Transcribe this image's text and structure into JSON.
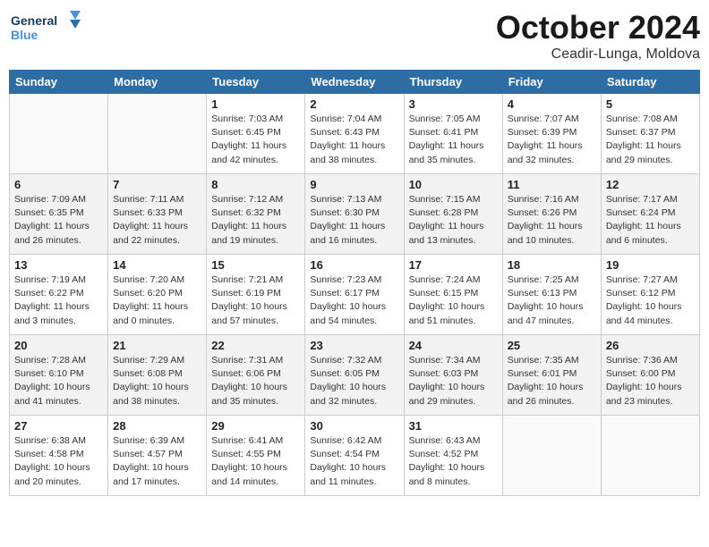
{
  "header": {
    "logo_line1": "General",
    "logo_line2": "Blue",
    "month": "October 2024",
    "location": "Ceadir-Lunga, Moldova"
  },
  "weekdays": [
    "Sunday",
    "Monday",
    "Tuesday",
    "Wednesday",
    "Thursday",
    "Friday",
    "Saturday"
  ],
  "weeks": [
    [
      {
        "day": "",
        "info": ""
      },
      {
        "day": "",
        "info": ""
      },
      {
        "day": "1",
        "info": "Sunrise: 7:03 AM\nSunset: 6:45 PM\nDaylight: 11 hours\nand 42 minutes."
      },
      {
        "day": "2",
        "info": "Sunrise: 7:04 AM\nSunset: 6:43 PM\nDaylight: 11 hours\nand 38 minutes."
      },
      {
        "day": "3",
        "info": "Sunrise: 7:05 AM\nSunset: 6:41 PM\nDaylight: 11 hours\nand 35 minutes."
      },
      {
        "day": "4",
        "info": "Sunrise: 7:07 AM\nSunset: 6:39 PM\nDaylight: 11 hours\nand 32 minutes."
      },
      {
        "day": "5",
        "info": "Sunrise: 7:08 AM\nSunset: 6:37 PM\nDaylight: 11 hours\nand 29 minutes."
      }
    ],
    [
      {
        "day": "6",
        "info": "Sunrise: 7:09 AM\nSunset: 6:35 PM\nDaylight: 11 hours\nand 26 minutes."
      },
      {
        "day": "7",
        "info": "Sunrise: 7:11 AM\nSunset: 6:33 PM\nDaylight: 11 hours\nand 22 minutes."
      },
      {
        "day": "8",
        "info": "Sunrise: 7:12 AM\nSunset: 6:32 PM\nDaylight: 11 hours\nand 19 minutes."
      },
      {
        "day": "9",
        "info": "Sunrise: 7:13 AM\nSunset: 6:30 PM\nDaylight: 11 hours\nand 16 minutes."
      },
      {
        "day": "10",
        "info": "Sunrise: 7:15 AM\nSunset: 6:28 PM\nDaylight: 11 hours\nand 13 minutes."
      },
      {
        "day": "11",
        "info": "Sunrise: 7:16 AM\nSunset: 6:26 PM\nDaylight: 11 hours\nand 10 minutes."
      },
      {
        "day": "12",
        "info": "Sunrise: 7:17 AM\nSunset: 6:24 PM\nDaylight: 11 hours\nand 6 minutes."
      }
    ],
    [
      {
        "day": "13",
        "info": "Sunrise: 7:19 AM\nSunset: 6:22 PM\nDaylight: 11 hours\nand 3 minutes."
      },
      {
        "day": "14",
        "info": "Sunrise: 7:20 AM\nSunset: 6:20 PM\nDaylight: 11 hours\nand 0 minutes."
      },
      {
        "day": "15",
        "info": "Sunrise: 7:21 AM\nSunset: 6:19 PM\nDaylight: 10 hours\nand 57 minutes."
      },
      {
        "day": "16",
        "info": "Sunrise: 7:23 AM\nSunset: 6:17 PM\nDaylight: 10 hours\nand 54 minutes."
      },
      {
        "day": "17",
        "info": "Sunrise: 7:24 AM\nSunset: 6:15 PM\nDaylight: 10 hours\nand 51 minutes."
      },
      {
        "day": "18",
        "info": "Sunrise: 7:25 AM\nSunset: 6:13 PM\nDaylight: 10 hours\nand 47 minutes."
      },
      {
        "day": "19",
        "info": "Sunrise: 7:27 AM\nSunset: 6:12 PM\nDaylight: 10 hours\nand 44 minutes."
      }
    ],
    [
      {
        "day": "20",
        "info": "Sunrise: 7:28 AM\nSunset: 6:10 PM\nDaylight: 10 hours\nand 41 minutes."
      },
      {
        "day": "21",
        "info": "Sunrise: 7:29 AM\nSunset: 6:08 PM\nDaylight: 10 hours\nand 38 minutes."
      },
      {
        "day": "22",
        "info": "Sunrise: 7:31 AM\nSunset: 6:06 PM\nDaylight: 10 hours\nand 35 minutes."
      },
      {
        "day": "23",
        "info": "Sunrise: 7:32 AM\nSunset: 6:05 PM\nDaylight: 10 hours\nand 32 minutes."
      },
      {
        "day": "24",
        "info": "Sunrise: 7:34 AM\nSunset: 6:03 PM\nDaylight: 10 hours\nand 29 minutes."
      },
      {
        "day": "25",
        "info": "Sunrise: 7:35 AM\nSunset: 6:01 PM\nDaylight: 10 hours\nand 26 minutes."
      },
      {
        "day": "26",
        "info": "Sunrise: 7:36 AM\nSunset: 6:00 PM\nDaylight: 10 hours\nand 23 minutes."
      }
    ],
    [
      {
        "day": "27",
        "info": "Sunrise: 6:38 AM\nSunset: 4:58 PM\nDaylight: 10 hours\nand 20 minutes."
      },
      {
        "day": "28",
        "info": "Sunrise: 6:39 AM\nSunset: 4:57 PM\nDaylight: 10 hours\nand 17 minutes."
      },
      {
        "day": "29",
        "info": "Sunrise: 6:41 AM\nSunset: 4:55 PM\nDaylight: 10 hours\nand 14 minutes."
      },
      {
        "day": "30",
        "info": "Sunrise: 6:42 AM\nSunset: 4:54 PM\nDaylight: 10 hours\nand 11 minutes."
      },
      {
        "day": "31",
        "info": "Sunrise: 6:43 AM\nSunset: 4:52 PM\nDaylight: 10 hours\nand 8 minutes."
      },
      {
        "day": "",
        "info": ""
      },
      {
        "day": "",
        "info": ""
      }
    ]
  ]
}
